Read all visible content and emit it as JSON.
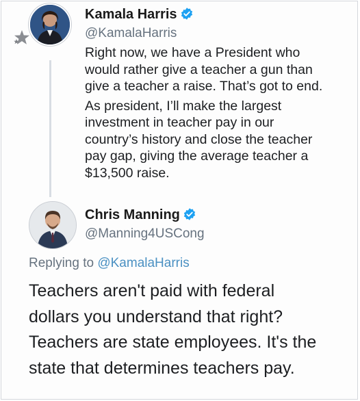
{
  "original_tweet": {
    "author_name": "Kamala Harris",
    "author_handle": "@KamalaHarris",
    "verified": true,
    "paragraph_1": "Right now, we have a President who\nwould rather give a teacher a gun than\ngive a teacher a raise. That’s got to end.",
    "paragraph_2": "As president, I’ll make the largest\ninvestment in teacher pay in our\ncountry’s history and close the teacher\npay gap, giving the average teacher a\n$13,500 raise."
  },
  "reply_tweet": {
    "author_name": "Chris Manning",
    "author_handle": "@Manning4USCong",
    "verified": true,
    "replying_prefix": "Replying to ",
    "replying_mention": "@KamalaHarris",
    "text": "Teachers aren't paid with federal\ndollars you understand that right?\nTeachers are state employees. It's the\nstate that determines teachers pay."
  },
  "colors": {
    "verified_badge": "#1da1f2",
    "mention": "#4a90c2",
    "secondary_text": "#66727f"
  },
  "icons": {
    "verified": "verified-badge-icon",
    "stars": "stars-badge-icon"
  }
}
